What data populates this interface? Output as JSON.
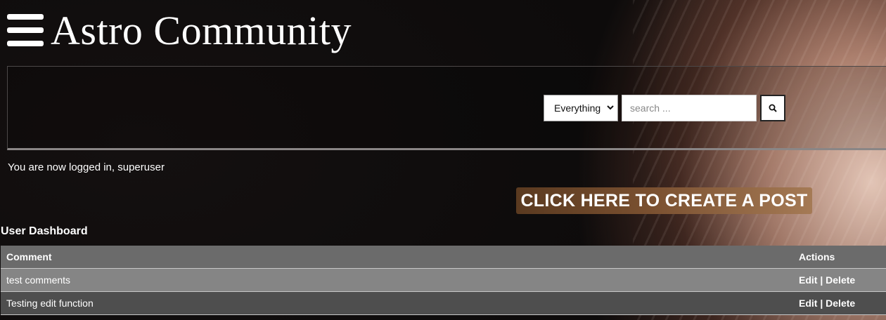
{
  "site": {
    "title": "Astro Community"
  },
  "search": {
    "scope_selected": "Everything",
    "placeholder": "search ..."
  },
  "status": {
    "logged_in_message": "You are now logged in, superuser"
  },
  "create_post": {
    "label": "CLICK HERE TO CREATE A POST"
  },
  "dashboard": {
    "title": "User Dashboard",
    "columns": {
      "comment": "Comment",
      "actions": "Actions"
    },
    "rows": [
      {
        "comment": "test comments",
        "edit": "Edit",
        "separator": "|",
        "delete": "Delete"
      },
      {
        "comment": "Testing edit function",
        "edit": "Edit",
        "separator": "|",
        "delete": "Delete"
      }
    ]
  },
  "icons": {
    "menu": "hamburger-menu-icon",
    "search": "search-icon",
    "dropdown": "chevron-down-icon"
  }
}
